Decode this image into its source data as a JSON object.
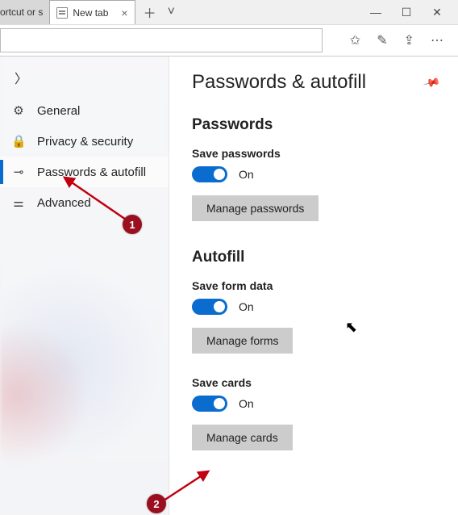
{
  "tabs": {
    "cut_tab_label": "ortcut or s",
    "active_tab_label": "New tab"
  },
  "sidebar": {
    "items": [
      {
        "label": "General"
      },
      {
        "label": "Privacy & security"
      },
      {
        "label": "Passwords & autofill"
      },
      {
        "label": "Advanced"
      }
    ]
  },
  "panel": {
    "title": "Passwords & autofill",
    "passwords": {
      "heading": "Passwords",
      "save_label": "Save passwords",
      "toggle_state": "On",
      "manage_btn": "Manage passwords"
    },
    "autofill": {
      "heading": "Autofill",
      "form": {
        "save_label": "Save form data",
        "toggle_state": "On",
        "manage_btn": "Manage forms"
      },
      "cards": {
        "save_label": "Save cards",
        "toggle_state": "On",
        "manage_btn": "Manage cards"
      }
    }
  },
  "annotations": {
    "b1": "1",
    "b2": "2"
  }
}
